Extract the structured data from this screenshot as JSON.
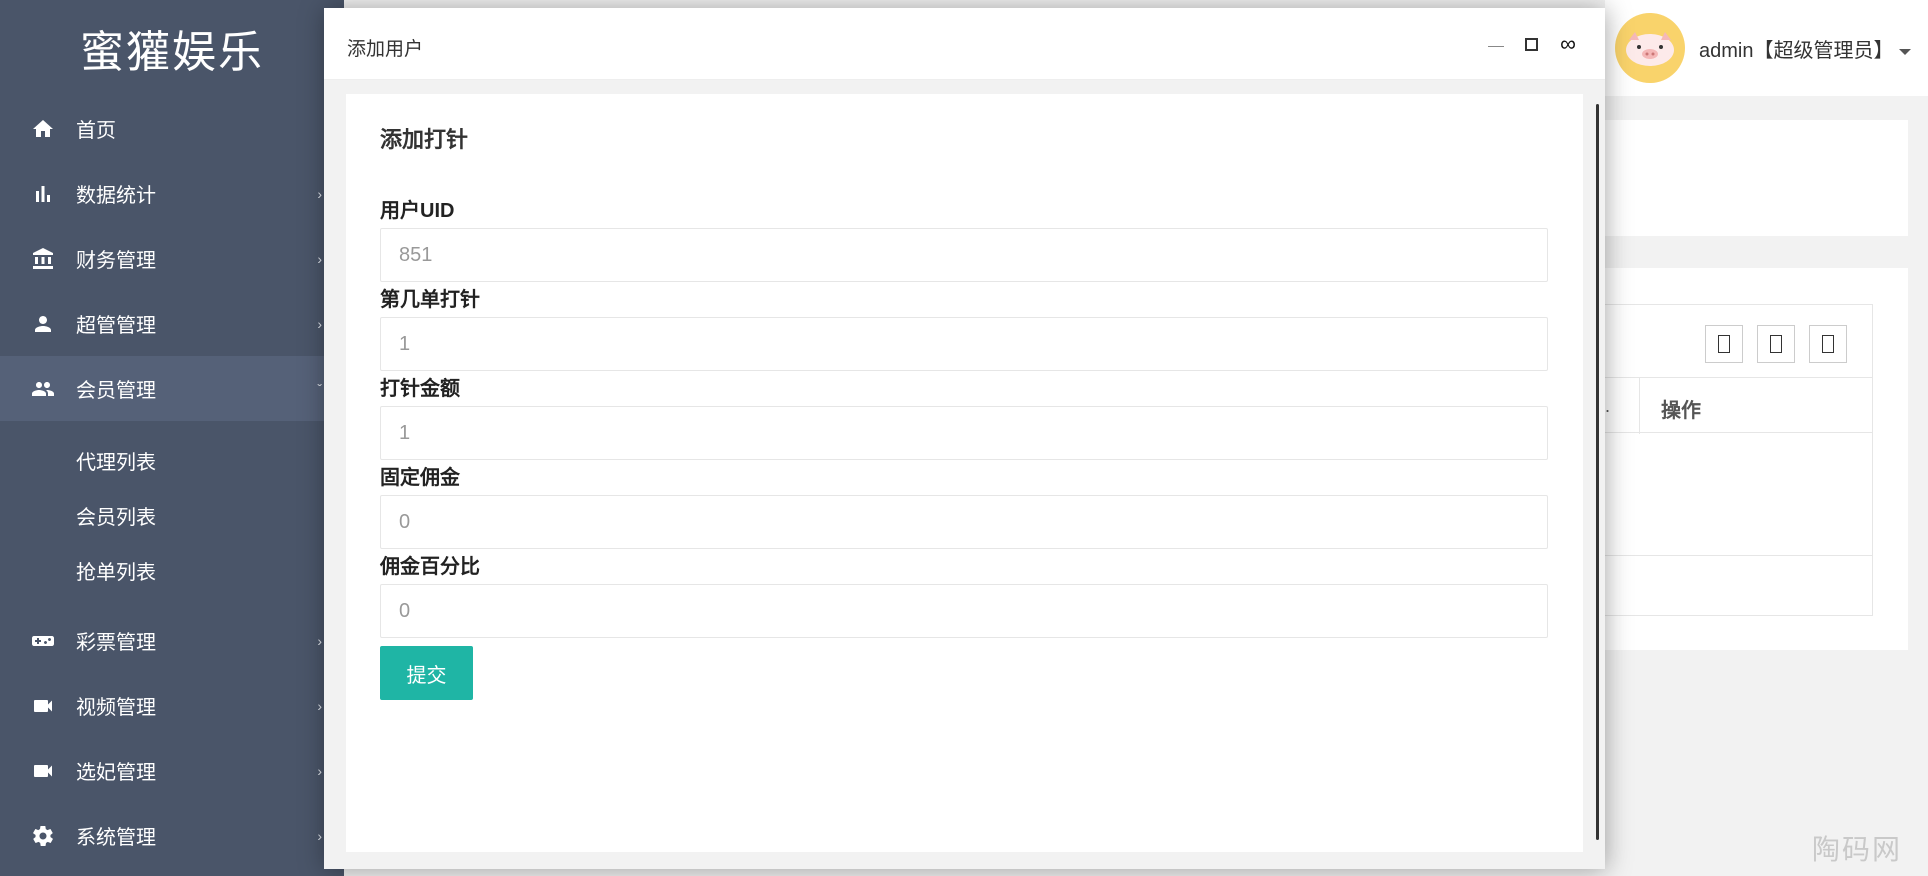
{
  "app": {
    "logo": "蜜獾娱乐"
  },
  "sidebar": {
    "items": [
      {
        "label": "首页",
        "icon": "home-icon",
        "has_submenu": false
      },
      {
        "label": "数据统计",
        "icon": "bar-chart-icon",
        "has_submenu": true
      },
      {
        "label": "财务管理",
        "icon": "bank-icon",
        "has_submenu": true
      },
      {
        "label": "超管管理",
        "icon": "person-icon",
        "has_submenu": true
      },
      {
        "label": "会员管理",
        "icon": "people-icon",
        "has_submenu": true,
        "expanded": true
      },
      {
        "label": "彩票管理",
        "icon": "gamepad-icon",
        "has_submenu": true
      },
      {
        "label": "视频管理",
        "icon": "video-icon",
        "has_submenu": true
      },
      {
        "label": "选妃管理",
        "icon": "video-icon",
        "has_submenu": true
      },
      {
        "label": "系统管理",
        "icon": "gear-icon",
        "has_submenu": true
      }
    ],
    "submenu": [
      "代理列表",
      "会员列表",
      "抢单列表"
    ],
    "chevron": "›",
    "chevron_open": "ˇ"
  },
  "header": {
    "user_label": "admin【超级管理员】"
  },
  "background": {
    "table_header": "操作",
    "table_header_cut": "."
  },
  "watermark": "陶码网",
  "modal": {
    "title": "添加用户",
    "close_glyph": "∞",
    "form": {
      "heading": "添加打针",
      "fields": [
        {
          "label": "用户UID",
          "placeholder": "851"
        },
        {
          "label": "第几单打针",
          "placeholder": "1"
        },
        {
          "label": "打针金额",
          "placeholder": "1"
        },
        {
          "label": "固定佣金",
          "placeholder": "0"
        },
        {
          "label": "佣金百分比",
          "placeholder": "0"
        }
      ],
      "submit_label": "提交"
    }
  },
  "colors": {
    "sidebar_bg": "#4a5569",
    "sidebar_active": "#556178",
    "submit_bg": "#1fb5a5",
    "avatar_bg": "#f9d36b"
  }
}
